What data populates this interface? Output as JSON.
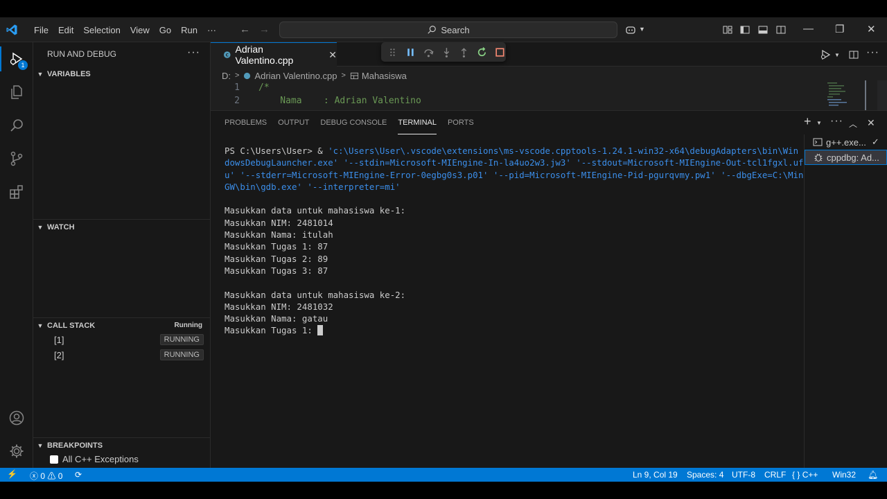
{
  "menu": [
    "File",
    "Edit",
    "Selection",
    "View",
    "Go",
    "Run",
    "···"
  ],
  "search": {
    "label": "Search"
  },
  "activity": {
    "debug_badge": "1"
  },
  "sidebar": {
    "title": "RUN AND DEBUG",
    "more": "···",
    "sections": {
      "variables": "VARIABLES",
      "watch": "WATCH",
      "call_stack": "CALL STACK",
      "call_stack_status": "Running",
      "breakpoints": "BREAKPOINTS"
    },
    "threads": [
      {
        "name": "[1]",
        "status": "RUNNING"
      },
      {
        "name": "[2]",
        "status": "RUNNING"
      }
    ],
    "breakpoint_items": [
      {
        "label": "All C++ Exceptions",
        "checked": false
      }
    ]
  },
  "editor": {
    "tab": {
      "icon": "C++",
      "label": "Adrian Valentino.cpp",
      "close": "✕"
    },
    "breadcrumb": [
      "D:",
      "Adrian Valentino.cpp",
      "Mahasiswa"
    ],
    "lines": [
      {
        "num": "1",
        "text": "/*"
      },
      {
        "num": "2",
        "text": "    Nama    : Adrian Valentino"
      }
    ]
  },
  "panel": {
    "tabs": [
      "PROBLEMS",
      "OUTPUT",
      "DEBUG CONSOLE",
      "TERMINAL",
      "PORTS"
    ],
    "active_tab": "TERMINAL",
    "terminals": [
      {
        "label": "g++.exe..."
      },
      {
        "label": "cppdbg: Ad..."
      }
    ]
  },
  "terminal": {
    "prompt": "PS C:\\Users\\User>",
    "amp": " & ",
    "cmd1": "'c:\\Users\\User\\.vscode\\extensions\\ms-vscode.cpptools-1.24.1-win32-x64\\debugAdapters\\bin\\Win",
    "cmd2": "dowsDebugLauncher.exe' '--stdin=Microsoft-MIEngine-In-la4uo2w3.jw3' '--stdout=Microsoft-MIEngine-Out-tcl1fgxl.uf",
    "cmd3": "u' '--stderr=Microsoft-MIEngine-Error-0egbg0s3.p01' '--pid=Microsoft-MIEngine-Pid-pgurqvmy.pw1' '--dbgExe=C:\\Min",
    "cmd4": "GW\\bin\\gdb.exe' '--interpreter=mi'",
    "output": [
      "",
      "Masukkan data untuk mahasiswa ke-1:",
      "Masukkan NIM: 2481014",
      "Masukkan Nama: itulah",
      "Masukkan Tugas 1: 87",
      "Masukkan Tugas 2: 89",
      "Masukkan Tugas 3: 87",
      "",
      "Masukkan data untuk mahasiswa ke-2:",
      "Masukkan NIM: 2481032",
      "Masukkan Nama: gatau"
    ],
    "last_line": "Masukkan Tugas 1: "
  },
  "statusbar": {
    "errors": "0",
    "warnings": "0",
    "position": "Ln 9, Col 19",
    "spaces": "Spaces: 4",
    "encoding": "UTF-8",
    "eol": "CRLF",
    "language": "C++",
    "platform": "Win32"
  },
  "colors": {
    "accent": "#0078d4",
    "statusbar": "#0078d4",
    "terminal_command": "#3b8eea",
    "comment": "#6a9955"
  }
}
